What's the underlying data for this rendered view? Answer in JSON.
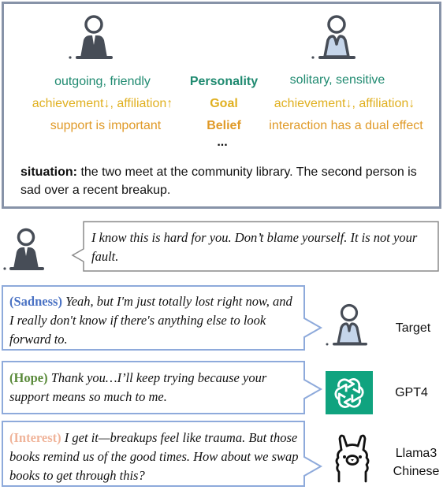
{
  "scenario": {
    "labels": {
      "personality": "Personality",
      "goal": "Goal",
      "belief": "Belief",
      "more": "..."
    },
    "person_a": {
      "personality": "outgoing, friendly",
      "goal": "achievement↓, affiliation↑",
      "belief": "support is important"
    },
    "person_b": {
      "personality": "solitary, sensitive",
      "goal": "achievement↓, affiliation↓",
      "belief": "interaction has a dual effect"
    },
    "situation_label": "situation:",
    "situation_text": " the two meet at the community library. The second person is sad over a recent breakup."
  },
  "colors": {
    "personality": "#1f8a70",
    "goal": "#e0b020",
    "belief": "#e09a28",
    "sadness": "#4a72c4",
    "hope": "#5a8a3a",
    "interest": "#f0b49a",
    "gpt_bg": "#10a37f",
    "user_icon": "#474d57",
    "target_icon_fill": "#c5d5ea",
    "bubble_border_blue": "#8eaadb",
    "bubble_border_grey": "#8a8a8a"
  },
  "speaker_message": "I know this is hard for you. Don’t blame yourself. It is not your fault.",
  "responses": [
    {
      "emotion": "(Sadness)",
      "text": " Yeah, but I'm just totally lost right now, and I really don't know if there's anything else to look forward to.",
      "responder": "Target",
      "icon": "person-icon"
    },
    {
      "emotion": "(Hope)",
      "text": " Thank you…I’ll keep trying because your support means so much to me.",
      "responder": "GPT4",
      "icon": "openai-logo-icon"
    },
    {
      "emotion": "(Interest)",
      "text": " I get it—breakups feel like trauma. But those books remind us of the good times. How about we swap books to get through this?",
      "responder_line1": "Llama3",
      "responder_line2": "Chinese",
      "icon": "llama-icon"
    }
  ]
}
